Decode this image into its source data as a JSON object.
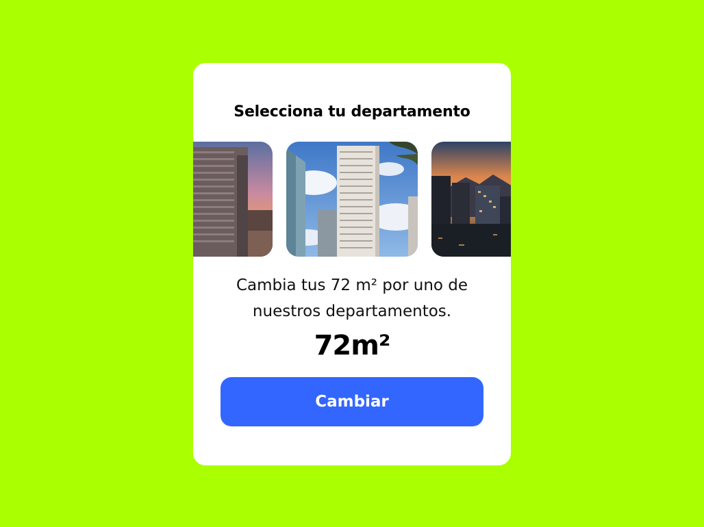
{
  "card": {
    "title": "Selecciona tu departamento",
    "description": "Cambia tus 72 m² por uno de nuestros departamentos.",
    "area": "72m²",
    "button_label": "Cambiar"
  },
  "carousel": {
    "images": [
      "building-sunset",
      "building-tower-sky",
      "city-dusk-mountains"
    ]
  },
  "colors": {
    "background": "#aaff00",
    "card": "#ffffff",
    "button": "#3366ff"
  }
}
